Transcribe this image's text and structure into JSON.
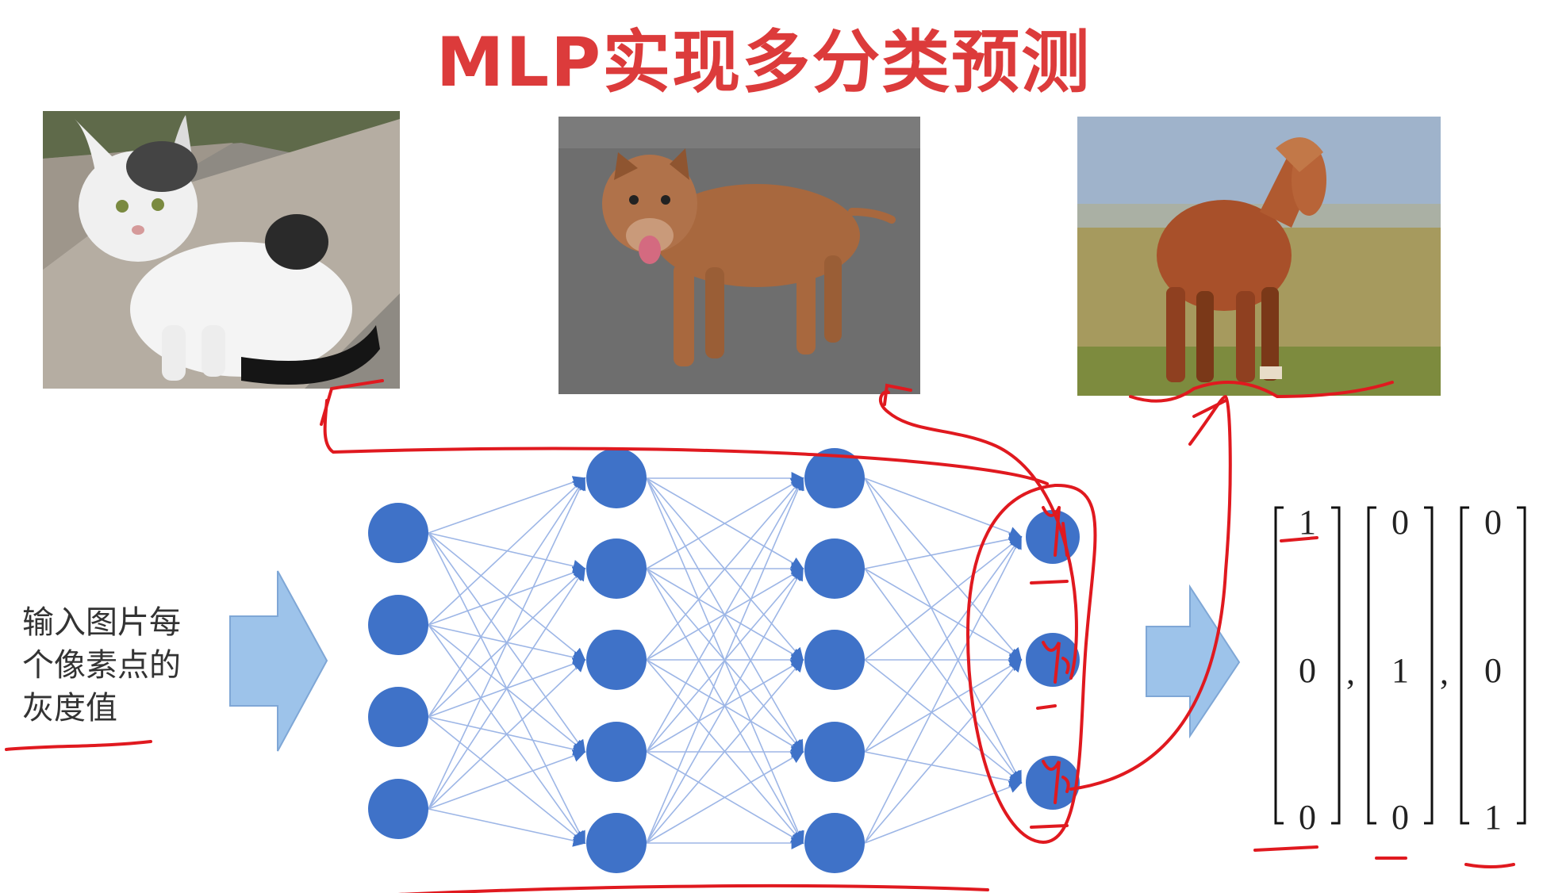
{
  "title": "MLP实现多分类预测",
  "images": [
    {
      "name": "cat-photo",
      "subject": "cat"
    },
    {
      "name": "dog-photo",
      "subject": "dog"
    },
    {
      "name": "horse-photo",
      "subject": "horse"
    }
  ],
  "input_caption": [
    "输入图片每",
    "个像素点的",
    "灰度值"
  ],
  "network": {
    "layers": [
      4,
      5,
      5,
      3
    ],
    "output_labels": [
      "y1",
      "y2",
      "y3"
    ],
    "node_color": "#3f72c8",
    "edge_color": "#9db6e6"
  },
  "one_hot_vectors": [
    [
      "1",
      "0",
      "0"
    ],
    [
      "0",
      "1",
      "0"
    ],
    [
      "0",
      "0",
      "1"
    ]
  ],
  "separators": [
    ",",
    ","
  ],
  "annotation_color": "#e0191f"
}
